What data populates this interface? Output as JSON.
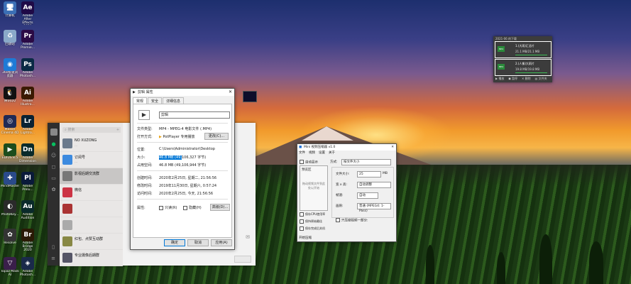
{
  "desktop_icons": [
    {
      "id": "computer",
      "label": "计算机",
      "icon": "computer-icon",
      "color": "#3b6fb5",
      "glyph": "🖥"
    },
    {
      "id": "ae",
      "label": "Adobe After Effects 2020",
      "icon": "after-effects-icon",
      "color": "#1f0a47",
      "glyph": "Ae"
    },
    {
      "id": "recycle",
      "label": "回收站",
      "icon": "recycle-bin-icon",
      "color": "#8aa9c9",
      "glyph": "♻"
    },
    {
      "id": "pr",
      "label": "Adobe Premie...",
      "icon": "premiere-icon",
      "color": "#2a0a45",
      "glyph": "Pr"
    },
    {
      "id": "360",
      "label": "360极速浏览器",
      "icon": "browser-360-icon",
      "color": "#1e7ad6",
      "glyph": "◉"
    },
    {
      "id": "ps",
      "label": "Adobe Photosh...",
      "icon": "photoshop-icon",
      "color": "#0a2a45",
      "glyph": "Ps"
    },
    {
      "id": "qq",
      "label": "腾讯QQ",
      "icon": "qq-icon",
      "color": "#111",
      "glyph": "🐧"
    },
    {
      "id": "ai",
      "label": "Adobe Illustra...",
      "icon": "illustrator-icon",
      "color": "#3a1a00",
      "glyph": "Ai"
    },
    {
      "id": "c4d",
      "label": "Maxon Cinema 4D",
      "icon": "cinema4d-icon",
      "color": "#202a55",
      "glyph": "◎"
    },
    {
      "id": "lr",
      "label": "Adobe Lightro...",
      "icon": "lightroom-icon",
      "color": "#0a2233",
      "glyph": "Lr"
    },
    {
      "id": "edius",
      "label": "EDIUS 8.5",
      "icon": "edius-icon",
      "color": "#1c4d1c",
      "glyph": "▶"
    },
    {
      "id": "dn",
      "label": "Adobe Dimension",
      "icon": "dimension-icon",
      "color": "#0a2a2a",
      "glyph": "Dn"
    },
    {
      "id": "mindmaster",
      "label": "MindMaster",
      "icon": "mindmaster-icon",
      "color": "#2a4a8a",
      "glyph": "✚"
    },
    {
      "id": "pl",
      "label": "Adobe Prelu...",
      "icon": "prelude-icon",
      "color": "#0a1a3a",
      "glyph": "Pl"
    },
    {
      "id": "photokey",
      "label": "PhotoKey...",
      "icon": "photokey-icon",
      "color": "#2a2a2a",
      "glyph": "◐"
    },
    {
      "id": "au",
      "label": "Adobe Audition",
      "icon": "audition-icon",
      "color": "#0a2a2a",
      "glyph": "Au"
    },
    {
      "id": "resolve",
      "label": "Resolve",
      "icon": "davinci-resolve-icon",
      "color": "#333",
      "glyph": "✿"
    },
    {
      "id": "br",
      "label": "Adobe Bridge 2020",
      "icon": "bridge-icon",
      "color": "#2a1a05",
      "glyph": "Br"
    },
    {
      "id": "topaz",
      "label": "Topaz Mask AI",
      "icon": "topaz-icon",
      "color": "#3a1f4a",
      "glyph": "▽"
    },
    {
      "id": "pse",
      "label": "Adobe Photosh...",
      "icon": "photoshop-elements-icon",
      "color": "#1a2a4a",
      "glyph": "◈"
    }
  ],
  "wechat": {
    "search_placeholder": "搜索",
    "plus": "+",
    "sidebar_icons": [
      "chat-icon",
      "contacts-icon",
      "favorites-icon",
      "files-icon",
      "moments-icon",
      "settings-icon"
    ],
    "chats": [
      {
        "name": "NO XUZONG",
        "msg": "...",
        "time": "",
        "avatar": "#6b7a8c"
      },
      {
        "name": "订阅号",
        "msg": "...",
        "time": "",
        "avatar": "#3c8adf"
      },
      {
        "name": "影视后期交流群",
        "msg": "",
        "time": "",
        "avatar": "#777"
      },
      {
        "name": "微信",
        "msg": "...",
        "time": "",
        "avatar": "#c34"
      },
      {
        "name": "",
        "msg": "",
        "time": "",
        "avatar": "#a33"
      },
      {
        "name": "",
        "msg": "",
        "time": "",
        "avatar": "#aaa"
      },
      {
        "name": "红包、点赞互动群",
        "msg": "",
        "time": "",
        "avatar": "#884"
      },
      {
        "name": "专业摄像后期群",
        "msg": "",
        "time": "",
        "avatar": "#556"
      }
    ]
  },
  "props": {
    "title": "剪辑 属性",
    "tabs": [
      "常规",
      "安全",
      "详细信息"
    ],
    "filename": "剪辑",
    "labels": {
      "type": "文件类型:",
      "open": "打开方式:",
      "location": "位置:",
      "size": "大小:",
      "disk": "占用空间:",
      "created": "创建时间:",
      "modified": "修改时间:",
      "accessed": "访问时间:",
      "attrs": "属性:"
    },
    "values": {
      "type": "MP4 - MPEG-4 电影文件 (.MP4)",
      "open": "PotPlayer 专用播放",
      "change_btn": "更改(C)...",
      "location": "C:\\Users\\Administrator\\Desktop",
      "size_hl": "46.8 MB (49,",
      "size_rest": "106,327 字节)",
      "disk": "46.8 MB (49,106,944 字节)",
      "created": "2020年2月25日, 星期二, 21:56:56",
      "modified": "2019年11月30日, 星期六, 0:57:24",
      "accessed": "2020年2月25日, 今天, 21:56:56",
      "readonly": "只读(R)",
      "hidden": "隐藏(H)",
      "advanced_btn": "高级(D)..."
    },
    "buttons": {
      "ok": "确定",
      "cancel": "取消",
      "apply": "应用(A)"
    }
  },
  "converter": {
    "title": "Mini  视频压缩器 v1.0",
    "menu": [
      "文件",
      "视频",
      "设置",
      "关于"
    ],
    "auto_display": "自动显示",
    "preview": "预览区",
    "drop_hint": "拖动视频文件到此处以开始",
    "method_lbl": "方式:",
    "method_val": "按文件大小",
    "size_lbl": "文件大小:",
    "size_val": "25",
    "size_unit": "MB",
    "res_lbl": "宽 x 高:",
    "res_val": "自动调整",
    "fps_lbl": "帧速:",
    "fps_val": "自动",
    "quality_lbl": "画质:",
    "quality_val": "普通 (MPEG4: 1-Pass)",
    "partial": "只压缩视频一部分:",
    "opt1": "保存CPU使用率",
    "opt2": "保持原始最佳",
    "opt3": "保存完成后关机",
    "go": "开始压缩"
  },
  "download": {
    "title": "2021-06 的下载",
    "items": [
      {
        "name": "1.(大雨)汇总片",
        "status": "21.1 MB/21.1 MB",
        "progress": 1.0
      },
      {
        "name": "2.(人像)大雨片",
        "status": "19.8 MB/19.8 MB",
        "progress": 1.0
      }
    ],
    "icon_label": "MP4",
    "footer": [
      "▶ 播放",
      "◼ 暂停",
      "✕ 删除",
      "▤ 文件夹"
    ]
  }
}
